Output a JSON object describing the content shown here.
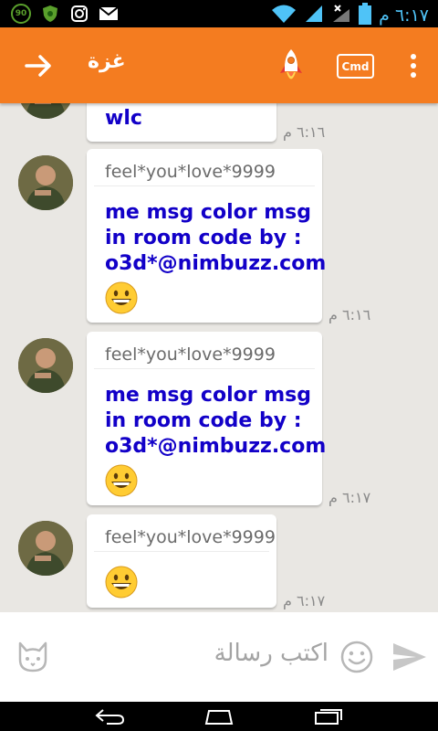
{
  "status_bar": {
    "badge_value": "90",
    "time": "٦:١٧ م",
    "icons": [
      "badge-90-icon",
      "shield-app-icon",
      "instagram-icon",
      "mail-icon",
      "wifi-icon",
      "signal-icon",
      "signal-x-icon",
      "battery-icon"
    ]
  },
  "toolbar": {
    "title": "غزة",
    "back_icon": "arrow-right-icon",
    "rocket_icon": "rocket-icon",
    "cmd_label": "Cmd",
    "more_icon": "more-vert-icon",
    "color": "#f47c20"
  },
  "messages": [
    {
      "sender": "",
      "lines": [
        "wlc"
      ],
      "emoji": false,
      "time": "٦:١٦ م"
    },
    {
      "sender": "feel*you*love*9999",
      "lines": [
        "me msg color msg",
        "in room code by :",
        "o3d*@nimbuzz.com"
      ],
      "emoji": true,
      "time": "٦:١٦ م"
    },
    {
      "sender": "feel*you*love*9999",
      "lines": [
        "me msg color msg",
        "in room code by :",
        "o3d*@nimbuzz.com"
      ],
      "emoji": true,
      "time": "٦:١٧ م"
    },
    {
      "sender": "feel*you*love*9999",
      "lines": [],
      "emoji": true,
      "time": "٦:١٧ م"
    }
  ],
  "compose": {
    "placeholder": "اكتب رسالة",
    "cat_icon": "cat-sticker-icon",
    "smiley_icon": "smiley-icon",
    "send_icon": "send-icon"
  },
  "nav_bar": {
    "icons": [
      "back-nav-icon",
      "home-nav-icon",
      "recents-nav-icon"
    ]
  },
  "colors": {
    "message_text": "#1200c8",
    "chat_background": "#e9e7e3"
  }
}
